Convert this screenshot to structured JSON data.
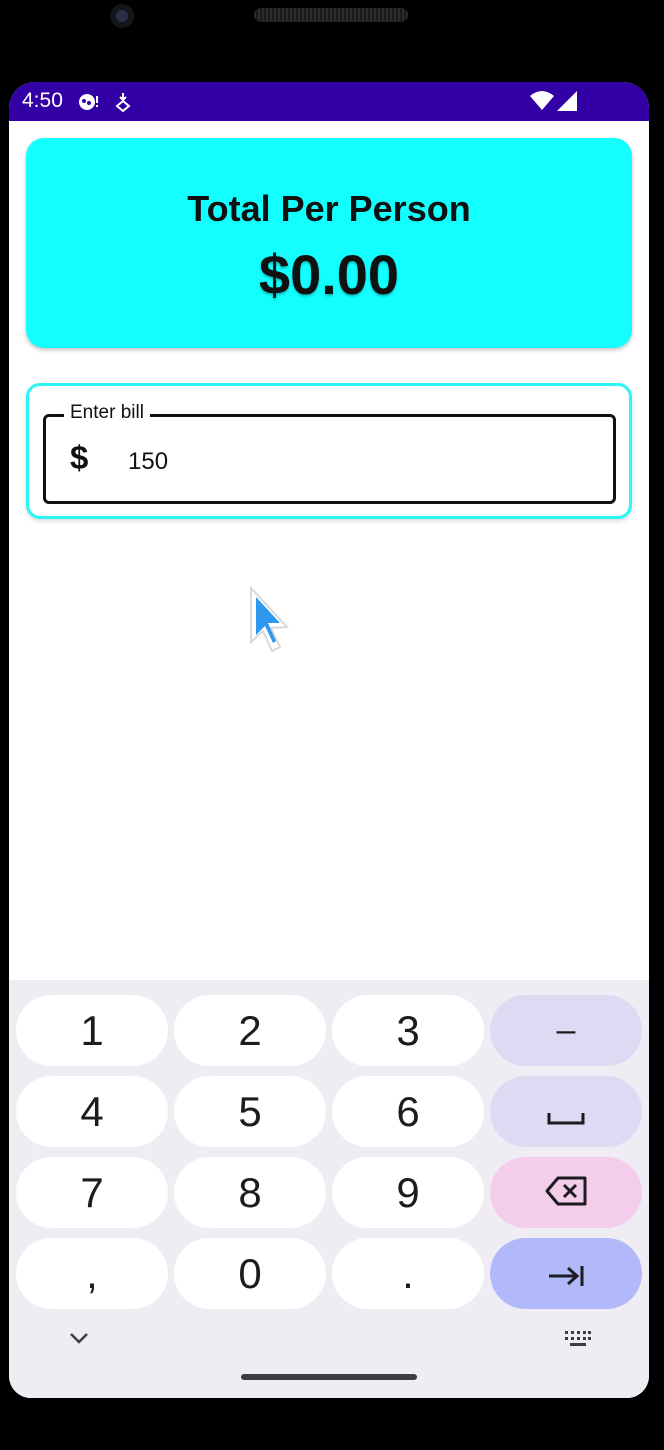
{
  "status_bar": {
    "time": "4:50",
    "icons": [
      "notification-icon",
      "download-icon",
      "wifi-icon",
      "signal-icon"
    ]
  },
  "total_card": {
    "label": "Total Per Person",
    "value": "$0.00"
  },
  "bill_input": {
    "label": "Enter bill",
    "prefix": "$",
    "value": "150"
  },
  "keyboard": {
    "rows": [
      [
        "1",
        "2",
        "3",
        "–"
      ],
      [
        "4",
        "5",
        "6",
        "space-icon"
      ],
      [
        "7",
        "8",
        "9",
        "backspace-icon"
      ],
      [
        ",",
        "0",
        ".",
        "next-icon"
      ]
    ]
  },
  "colors": {
    "status_bar": "#3200a4",
    "total_card": "#13ffff",
    "bill_card_border": "#2af6f6",
    "key_function": "#dcdbf3",
    "key_delete": "#f4cdea",
    "key_action": "#b1b9fb",
    "keyboard_bg": "#efedf3"
  }
}
